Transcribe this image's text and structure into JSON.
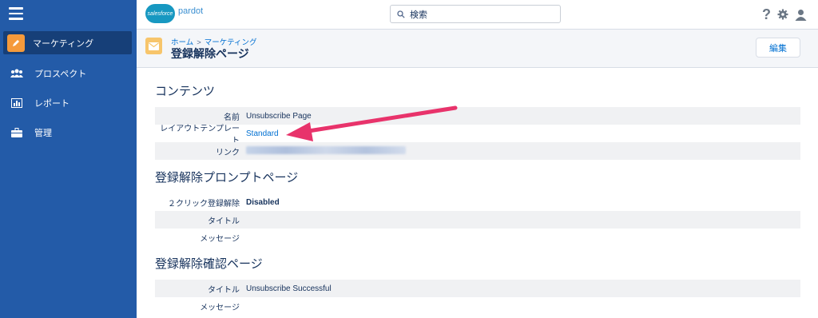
{
  "sidebar": {
    "items": [
      {
        "label": "マーケティング",
        "icon": "pencil-icon",
        "active": true
      },
      {
        "label": "プロスペクト",
        "icon": "people-icon"
      },
      {
        "label": "レポート",
        "icon": "chart-icon"
      },
      {
        "label": "管理",
        "icon": "briefcase-icon"
      }
    ]
  },
  "topbar": {
    "logo_cloud": "salesforce",
    "logo_text": "pardot",
    "search_placeholder": "検索"
  },
  "header": {
    "breadcrumb": [
      "ホーム",
      "マーケティング"
    ],
    "breadcrumb_sep": ">",
    "title": "登録解除ページ",
    "edit_label": "編集"
  },
  "sections": {
    "content": {
      "title": "コンテンツ",
      "rows": [
        {
          "label": "名前",
          "value": "Unsubscribe Page"
        },
        {
          "label": "レイアウトテンプレート",
          "value": "Standard"
        },
        {
          "label": "リンク",
          "value": ""
        }
      ]
    },
    "prompt": {
      "title": "登録解除プロンプトページ",
      "rows": [
        {
          "label": "２クリック登録解除",
          "value": "Disabled"
        },
        {
          "label": "タイトル",
          "value": ""
        },
        {
          "label": "メッセージ",
          "value": ""
        }
      ]
    },
    "confirm": {
      "title": "登録解除確認ページ",
      "rows": [
        {
          "label": "タイトル",
          "value": "Unsubscribe Successful"
        },
        {
          "label": "メッセージ",
          "value": ""
        }
      ]
    }
  },
  "colors": {
    "sidebar": "#235ba8",
    "sidebar_active": "#163f78",
    "accent_link": "#0070d2",
    "annotation_arrow": "#e8336b"
  }
}
